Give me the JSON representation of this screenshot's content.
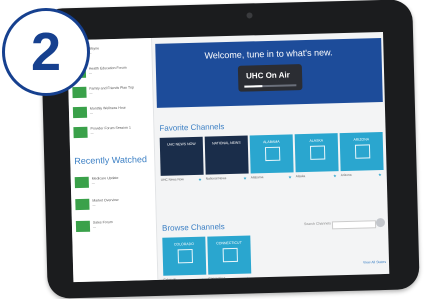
{
  "badge": {
    "number": "2"
  },
  "left": {
    "top_items": [
      {
        "t1": "Wayne",
        "t2": "—",
        "t3": ""
      },
      {
        "t1": "Health Education Forum",
        "t2": "—",
        "t3": ""
      },
      {
        "t1": "Family and Friends Plan Trip",
        "t2": "—",
        "t3": ""
      },
      {
        "t1": "Monthly Wellness Hour",
        "t2": "—",
        "t3": ""
      },
      {
        "t1": "Provider Forum Session 1",
        "t2": "—",
        "t3": ""
      }
    ],
    "recently_watched_title": "Recently Watched",
    "recent_items": [
      {
        "t1": "Medicare Update",
        "t2": "—",
        "t3": ""
      },
      {
        "t1": "Market Overview",
        "t2": "—",
        "t3": ""
      },
      {
        "t1": "Sales Forum",
        "t2": "—",
        "t3": ""
      }
    ]
  },
  "hero": {
    "welcome": "Welcome, tune in to what's new.",
    "logo": "UHC On Air",
    "progress": 0.35
  },
  "favorites": {
    "title": "Favorite Channels",
    "tiles": [
      {
        "label": "UHC NEWS NOW",
        "cap": "UHC News Now",
        "dark": true
      },
      {
        "label": "NATIONAL NEWS",
        "cap": "National News",
        "dark": true
      },
      {
        "label": "ALABAMA",
        "cap": "Alabama",
        "dark": false
      },
      {
        "label": "ALASKA",
        "cap": "Alaska",
        "dark": false
      },
      {
        "label": "ARIZONA",
        "cap": "Arizona",
        "dark": false
      }
    ]
  },
  "browse": {
    "title": "Browse Channels",
    "search_label": "Search Channels",
    "search_placeholder": "",
    "tiles": [
      {
        "label": "COLORADO",
        "cap": "Colorado",
        "dark": false
      },
      {
        "label": "CONNECTICUT",
        "cap": "Connecticut",
        "dark": false
      }
    ],
    "view_all": "View All States"
  }
}
